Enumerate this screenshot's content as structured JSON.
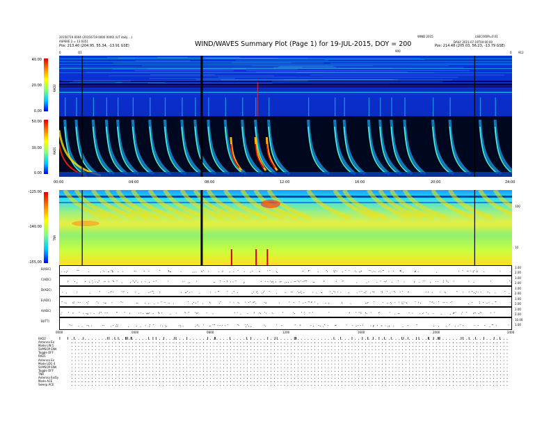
{
  "header": {
    "title": "WIND/WAVES Summary Plot (Page 1) for 19-JUL-2015, DOY = 200",
    "left1": "20150719 0004 (20150719 0000 0000) (UT daily ...)",
    "left2": "ASPERE 2 = 13.0351",
    "left_pos": "Pos: 213.40 (204.95, 55.34, -13.91 GSE)",
    "center_right": "WIND 2015",
    "right1": "LSEC/VDM=0.01",
    "right2": "DAILY 2015-07-19T00:00:00",
    "right_pos": "Pos: 214.48 (205.03, 56.23, -13.79 GSE)",
    "rad2_top": "RAD2",
    "rad1_top": "RAD1",
    "tnr_top": "TNR"
  },
  "top_markers": [
    "0",
    "Q1",
    "900",
    "0",
    "912"
  ],
  "rad2": {
    "label": "RAD2",
    "ticks": [
      "40.00",
      "20.00",
      "0.00"
    ]
  },
  "rad1": {
    "label": "RAD1",
    "ticks": [
      "50.00",
      "30.00",
      "0.00"
    ]
  },
  "tnr": {
    "label": "TNR",
    "ticks": [
      "-125.00",
      "-140.00",
      "-155.00"
    ],
    "right_ticks": [
      "100",
      "10"
    ]
  },
  "x_ticks": [
    "00:00",
    "04:00",
    "08:00",
    "12:00",
    "16:00",
    "20:00",
    "24:00"
  ],
  "x_ticks_bottom": [
    "0000",
    "0400",
    "0800",
    "1200",
    "1600",
    "2000",
    "2400"
  ],
  "line_panels": [
    {
      "label": "B(ADC)",
      "r1": "3.00",
      "r2": "2.00"
    },
    {
      "label": "C(ADC)",
      "r1": "3.00",
      "r2": "2.00"
    },
    {
      "label": "D(ADC)",
      "r1": "3.00",
      "r2": "2.00"
    },
    {
      "label": "E(ADC)",
      "r1": "3.00",
      "r2": "2.00"
    },
    {
      "label": "A(ADC)",
      "r1": "3.00",
      "r2": "2.00"
    },
    {
      "label": "B(ITT)",
      "r1": "10.00",
      "r2": "1.00"
    }
  ],
  "info_lines": [
    "RAD2",
    "Antenna  Ex",
    "Mode  LIN 5",
    "SUMSOP  ENA",
    "Toggle  OFF",
    "RAD1",
    "Antenna  Ex",
    "Mode  LOG 4",
    "SUMSOP  ENA",
    "Toggle  OFF",
    "TNR",
    "Antenna  Ex/Ey",
    "Mode  ACE",
    "Sweep  ACE"
  ],
  "chart_data": {
    "type": "heatmap",
    "title": "WIND/WAVES Summary Plot (Page 1) for 19-JUL-2015, DOY = 200",
    "x_range_hours": [
      0,
      24
    ],
    "panels": [
      {
        "name": "RAD2",
        "ylim": [
          0,
          40
        ]
      },
      {
        "name": "RAD1",
        "ylim": [
          0,
          50
        ]
      },
      {
        "name": "TNR",
        "ylim": [
          -155,
          -125
        ]
      }
    ],
    "type_iii_bursts_hours": [
      0.3,
      0.9,
      1.8,
      2.5,
      3.1,
      3.9,
      4.8,
      5.6,
      6.5,
      7.2,
      7.9,
      8.8,
      9.7,
      10.4,
      11.1,
      13.2,
      14.6,
      15.1,
      16.4,
      17.0,
      17.6,
      18.3,
      19.8,
      20.7,
      22.3,
      23.1
    ],
    "intense_bursts_hours": [
      9.1,
      10.4,
      11.0
    ],
    "data_gaps_hours": [
      1.2,
      7.5,
      22.0
    ],
    "colorscale": [
      "#000060",
      "#0000ff",
      "#00c8ff",
      "#80ff80",
      "#ffff00",
      "#ff8000",
      "#e00000"
    ]
  }
}
